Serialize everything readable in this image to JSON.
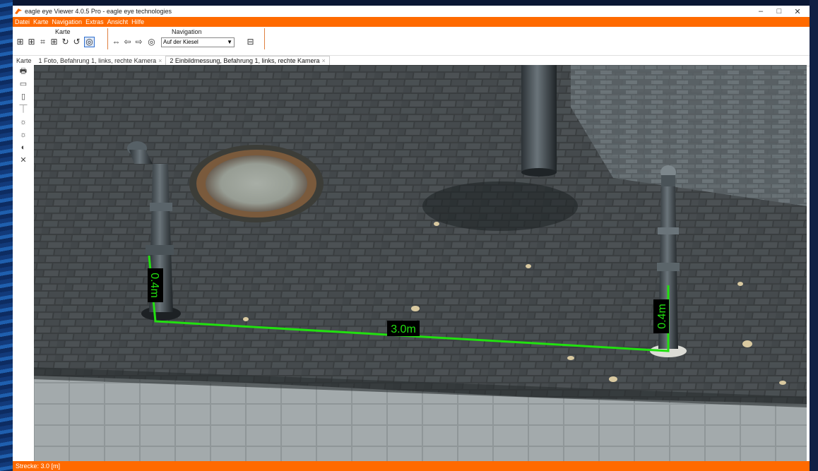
{
  "window": {
    "title": "eagle eye Viewer 4.0.5 Pro - eagle eye technologies",
    "controls": [
      "–",
      "□",
      "✕"
    ]
  },
  "menu": [
    "Datei",
    "Karte",
    "Navigation",
    "Extras",
    "Ansicht",
    "Hilfe"
  ],
  "ribbon": {
    "karte_label": "Karte",
    "navigation_label": "Navigation",
    "location_select": "Auf der Kiesel"
  },
  "tabs": [
    {
      "label": "Karte"
    },
    {
      "label": "1 Foto, Befahrung 1, links, rechte Kamera",
      "close": "×"
    },
    {
      "label": "2 Einbildmessung, Befahrung 1, links, rechte Kamera",
      "close": "×"
    }
  ],
  "measurements": {
    "distance": "3.0m",
    "left_height": "0.4m",
    "right_height": "0.4m"
  },
  "status": {
    "text": "Strecke:  3.0 [m]"
  },
  "colors": {
    "accent": "#ff6a00",
    "measure_line": "#22e010"
  }
}
